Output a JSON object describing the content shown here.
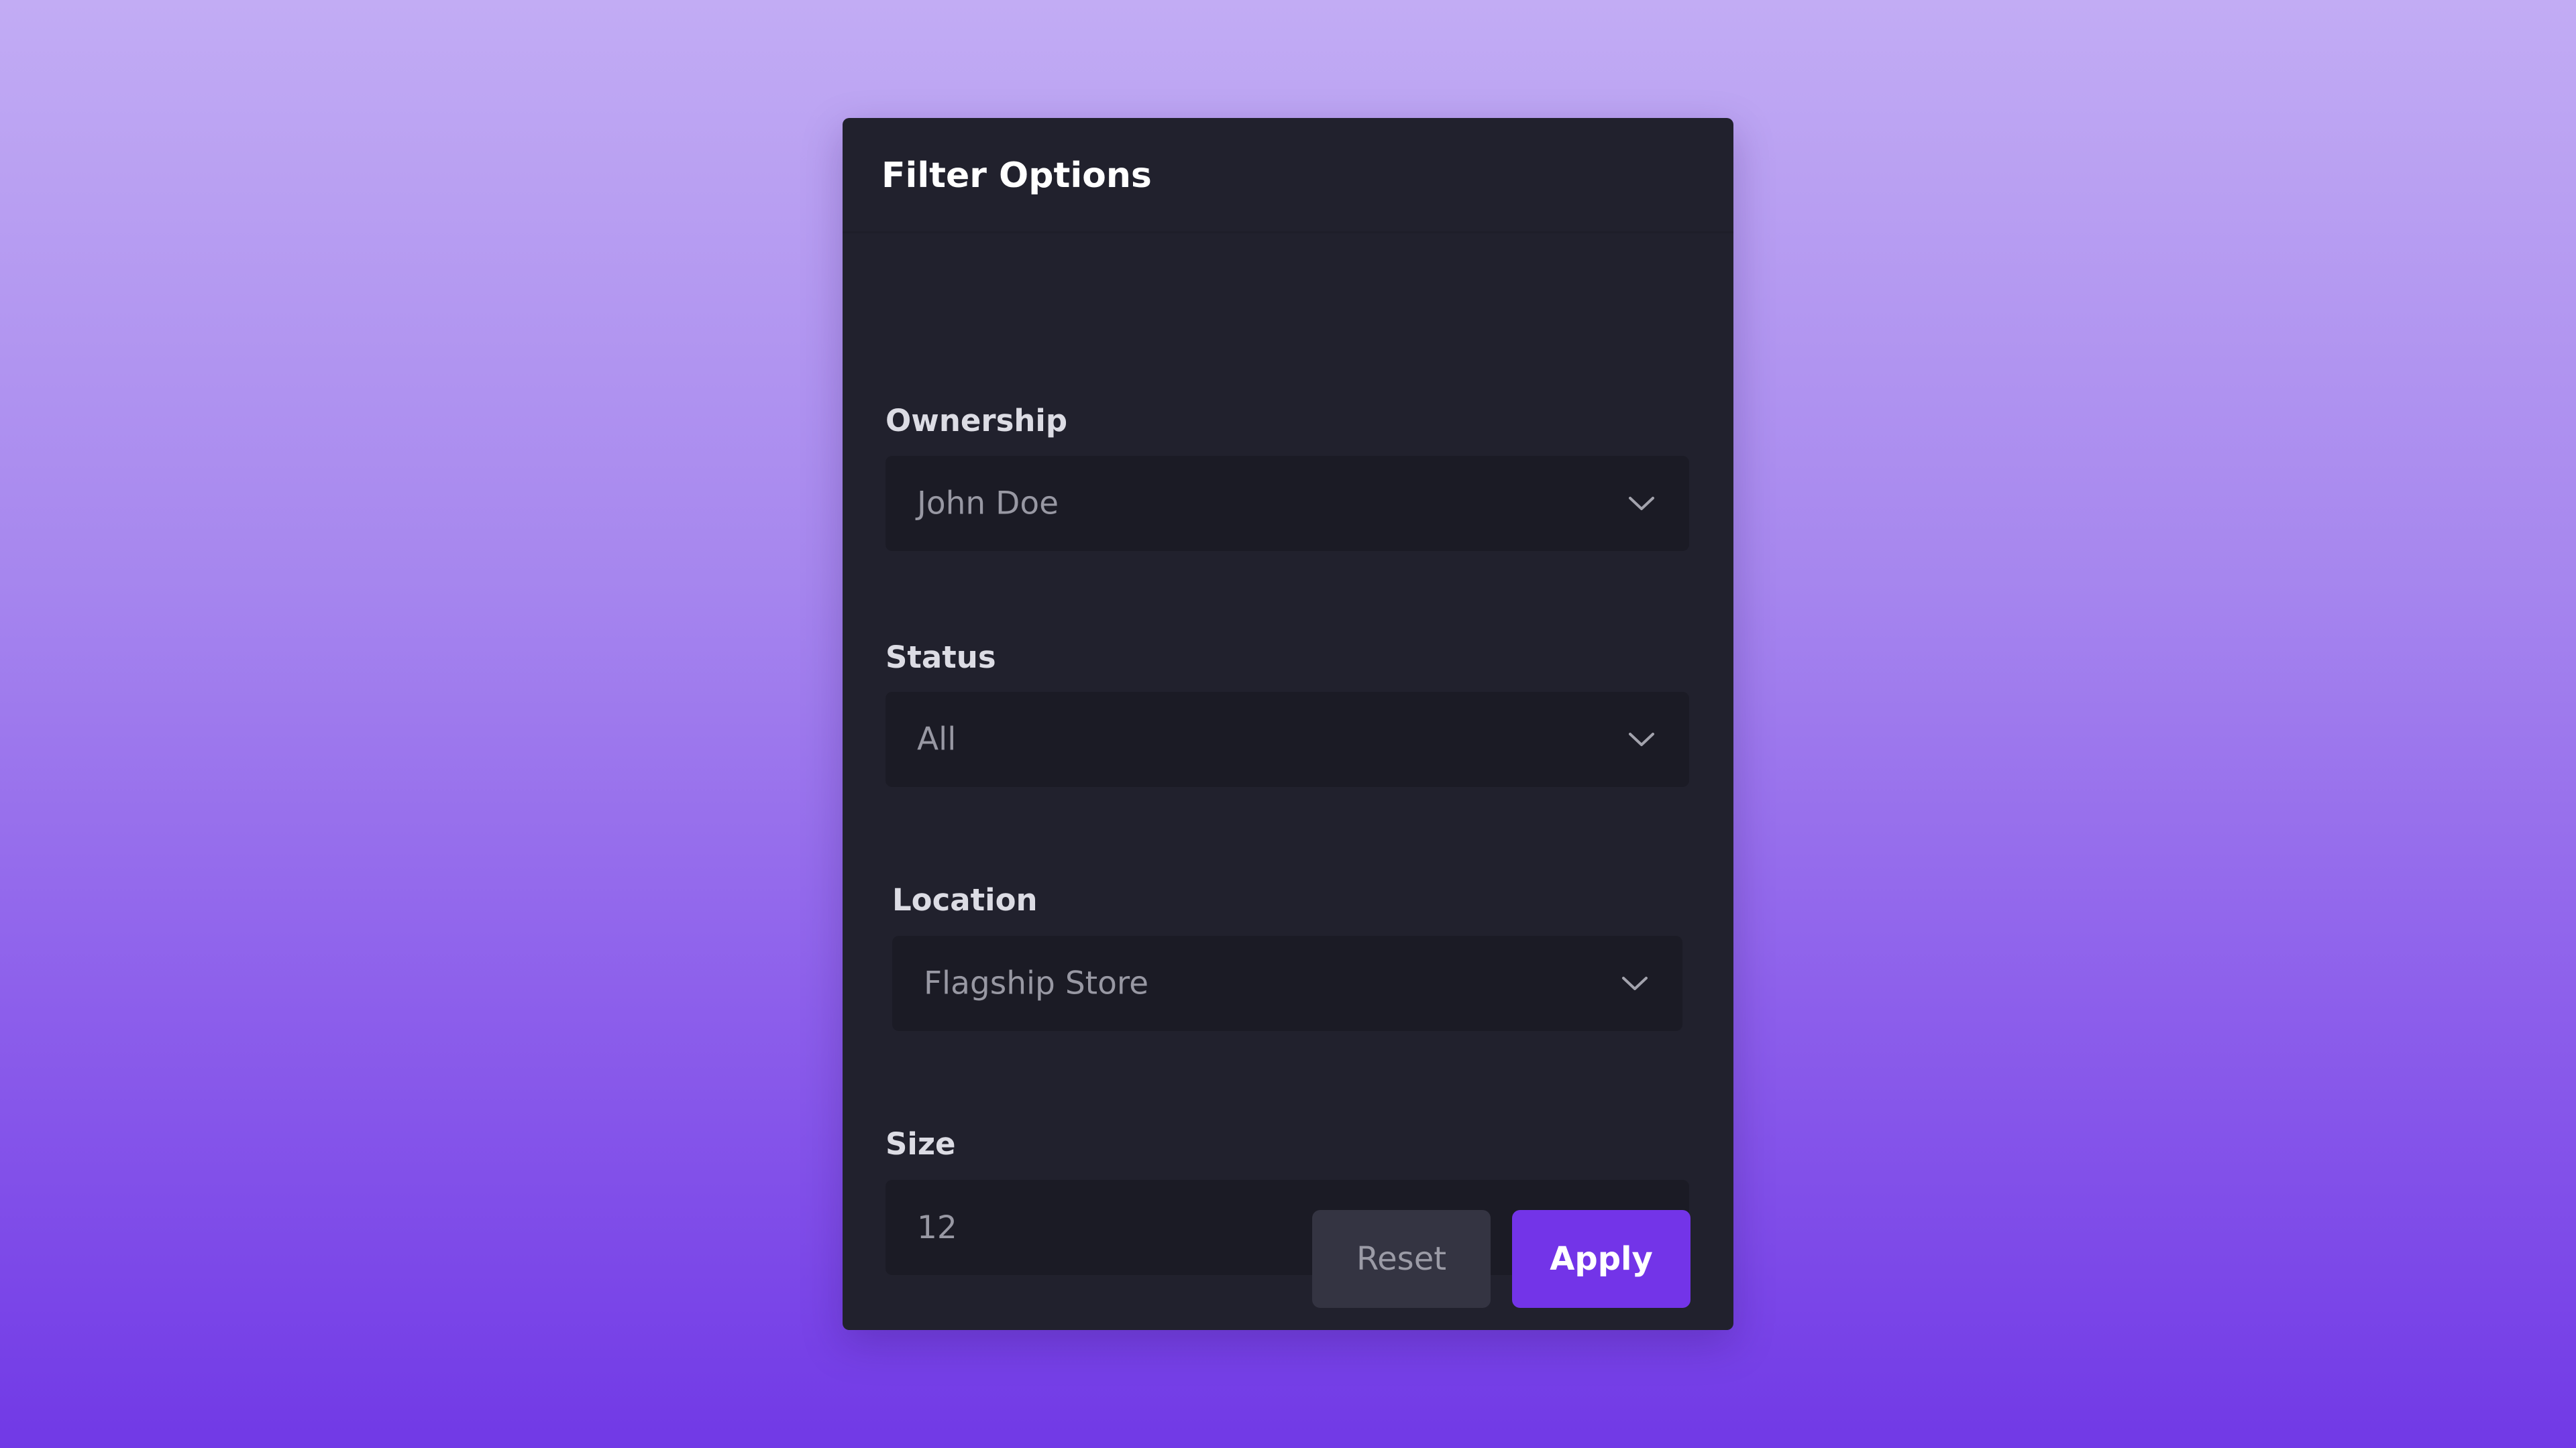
{
  "panel": {
    "title": "Filter Options"
  },
  "fields": {
    "ownership": {
      "label": "Ownership",
      "value": "John Doe"
    },
    "status": {
      "label": "Status",
      "value": "All"
    },
    "location": {
      "label": "Location",
      "value": "Flagship Store"
    },
    "size": {
      "label": "Size",
      "value": "12"
    }
  },
  "buttons": {
    "reset_label": "Reset",
    "apply_label": "Apply"
  },
  "colors": {
    "accent": "#7334e8",
    "panel_background": "#21212d",
    "input_background": "#1b1b25"
  },
  "icons": {
    "dropdown": "chevron-down-icon"
  }
}
